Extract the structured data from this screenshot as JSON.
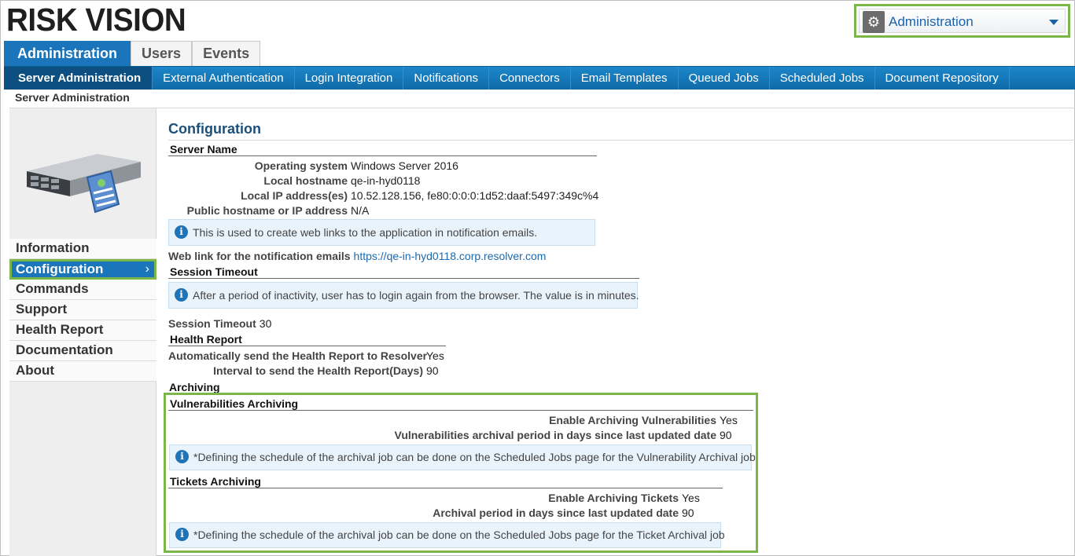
{
  "header": {
    "logo_text": "RISK VISION",
    "module_select": {
      "selected": "Administration",
      "icon": "gear-icon"
    }
  },
  "top_tabs": [
    {
      "label": "Administration",
      "active": true
    },
    {
      "label": "Users",
      "active": false
    },
    {
      "label": "Events",
      "active": false
    }
  ],
  "sub_nav": [
    {
      "label": "Server Administration",
      "active": true
    },
    {
      "label": "External Authentication"
    },
    {
      "label": "Login Integration"
    },
    {
      "label": "Notifications"
    },
    {
      "label": "Connectors"
    },
    {
      "label": "Email Templates"
    },
    {
      "label": "Queued Jobs"
    },
    {
      "label": "Scheduled Jobs"
    },
    {
      "label": "Document Repository"
    }
  ],
  "breadcrumb": "Server Administration",
  "sidebar": {
    "items": [
      {
        "label": "Information"
      },
      {
        "label": "Configuration",
        "active": true
      },
      {
        "label": "Commands"
      },
      {
        "label": "Support"
      },
      {
        "label": "Health Report"
      },
      {
        "label": "Documentation"
      },
      {
        "label": "About"
      }
    ],
    "active_chevron": "›"
  },
  "main": {
    "title": "Configuration",
    "server_name": {
      "heading": "Server Name",
      "os_label": "Operating system",
      "os_value": "Windows Server 2016",
      "host_label": "Local hostname",
      "host_value": "qe-in-hyd0118",
      "ip_label": "Local IP address(es)",
      "ip_value": "10.52.128.156, fe80:0:0:0:1d52:daaf:5497:349c%4",
      "public_label": "Public hostname or IP address",
      "public_value": "N/A",
      "info": "This is used to create web links to the application in notification emails.",
      "weblink_label": "Web link for the notification emails",
      "weblink_value": "https://qe-in-hyd0118.corp.resolver.com"
    },
    "session": {
      "heading": "Session Timeout",
      "info": "After a period of inactivity, user has to login again from the browser. The value is in minutes.",
      "timeout_label": "Session Timeout",
      "timeout_value": "30"
    },
    "health": {
      "heading": "Health Report",
      "auto_label": "Automatically send the Health Report to Resolver",
      "auto_value": "Yes",
      "interval_label": "Interval to send the Health Report(Days)",
      "interval_value": "90"
    },
    "archiving": {
      "heading": "Archiving",
      "vuln": {
        "heading": "Vulnerabilities Archiving",
        "enable_label": "Enable Archiving Vulnerabilities",
        "enable_value": "Yes",
        "period_label": "Vulnerabilities archival period in days since last updated date",
        "period_value": "90",
        "info": "*Defining the schedule of the archival job can be done on the Scheduled Jobs page for the Vulnerability Archival job"
      },
      "tickets": {
        "heading": "Tickets Archiving",
        "enable_label": "Enable Archiving Tickets",
        "enable_value": "Yes",
        "period_label": "Archival period in days since last updated date",
        "period_value": "90",
        "info": "*Defining the schedule of the archival job can be done on the Scheduled Jobs page for the Ticket Archival job"
      }
    }
  },
  "colors": {
    "accent_blue": "#1b75bb",
    "highlight_green": "#7ab648",
    "title_blue": "#1b4f7a"
  }
}
